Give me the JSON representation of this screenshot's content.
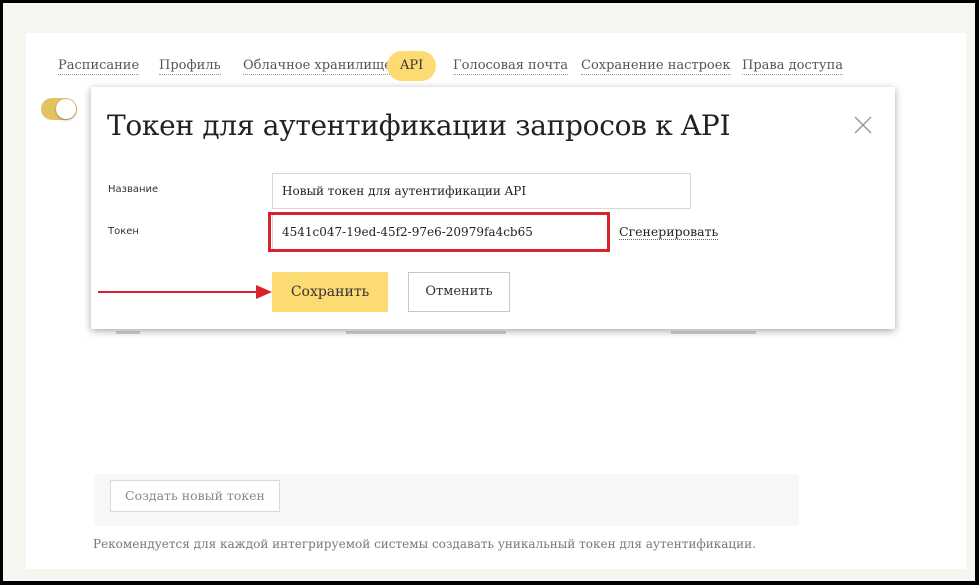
{
  "tabs": [
    {
      "label": "Расписание"
    },
    {
      "label": "Профиль"
    },
    {
      "label": "Облачное хранилище"
    },
    {
      "label": "API"
    },
    {
      "label": "Голосовая почта"
    },
    {
      "label": "Сохранение настроек"
    },
    {
      "label": "Права доступа"
    }
  ],
  "active_tab": "API",
  "modal": {
    "title": "Токен для аутентификации запросов к API",
    "name_label": "Название",
    "name_value": "Новый токен для аутентификации API",
    "token_label": "Токен",
    "token_value": "4541c047-19ed-45f2-97e6-20979fa4cb65",
    "generate_label": "Сгенерировать",
    "save_label": "Сохранить",
    "cancel_label": "Отменить"
  },
  "create_token_label": "Создать новый токен",
  "recommendation": "Рекомендуется для каждой интегрируемой системы создавать уникальный токен для аутентификации.",
  "colors": {
    "accent": "#fddb73",
    "highlight": "#d8232a"
  },
  "icons": {
    "close": "close-icon",
    "arrow": "arrow-right-icon"
  }
}
